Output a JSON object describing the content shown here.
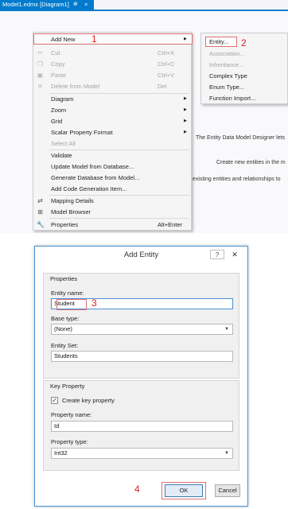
{
  "top": {
    "tab_title": "Model1.edmx [Diagram1]",
    "tab_pin": "⊕",
    "tab_close": "×",
    "canvas_lines": [
      "The Entity Data Model Designer lets",
      "Create new entities in the m",
      "existing entities and relationships to"
    ],
    "context_menu": {
      "add_new": {
        "label": "Add New",
        "step": "1"
      },
      "cut": {
        "label": "Cut",
        "shortcut": "Ctrl+X"
      },
      "copy": {
        "label": "Copy",
        "shortcut": "Ctrl+C"
      },
      "paste": {
        "label": "Paste",
        "shortcut": "Ctrl+V"
      },
      "delete": {
        "label": "Delete from Model",
        "shortcut": "Del"
      },
      "diagram": {
        "label": "Diagram"
      },
      "zoom": {
        "label": "Zoom"
      },
      "grid": {
        "label": "Grid"
      },
      "scalar": {
        "label": "Scalar Property Format"
      },
      "select_all": {
        "label": "Select All"
      },
      "validate": {
        "label": "Validate"
      },
      "update": {
        "label": "Update Model from Database..."
      },
      "generate": {
        "label": "Generate Database from Model..."
      },
      "add_code": {
        "label": "Add Code Generation Item..."
      },
      "mapping": {
        "label": "Mapping Details"
      },
      "browser": {
        "label": "Model Browser"
      },
      "properties": {
        "label": "Properties",
        "shortcut": "Alt+Enter"
      }
    },
    "submenu": {
      "entity": "Entity...",
      "step": "2",
      "association": "Association...",
      "inheritance": "Inheritance...",
      "complex_type": "Complex Type",
      "enum_type": "Enum Type...",
      "function_import": "Function Import..."
    }
  },
  "dialog": {
    "title": "Add Entity",
    "help": "?",
    "close": "✕",
    "properties_group": "Properties",
    "entity_name_label": "Entity name:",
    "entity_name_value": "Student",
    "step3": "3",
    "base_type_label": "Base type:",
    "base_type_value": "(None)",
    "entity_set_label": "Entity Set:",
    "entity_set_value": "Students",
    "key_group": "Key Property",
    "create_key_label": "Create key property",
    "create_key_checked": true,
    "property_name_label": "Property name:",
    "property_name_value": "Id",
    "property_type_label": "Property type:",
    "property_type_value": "Int32",
    "ok": "OK",
    "cancel": "Cancel",
    "step4": "4"
  },
  "colors": {
    "accent": "#007acc",
    "step_marker": "#e02020",
    "highlight_border": "#e07070"
  }
}
